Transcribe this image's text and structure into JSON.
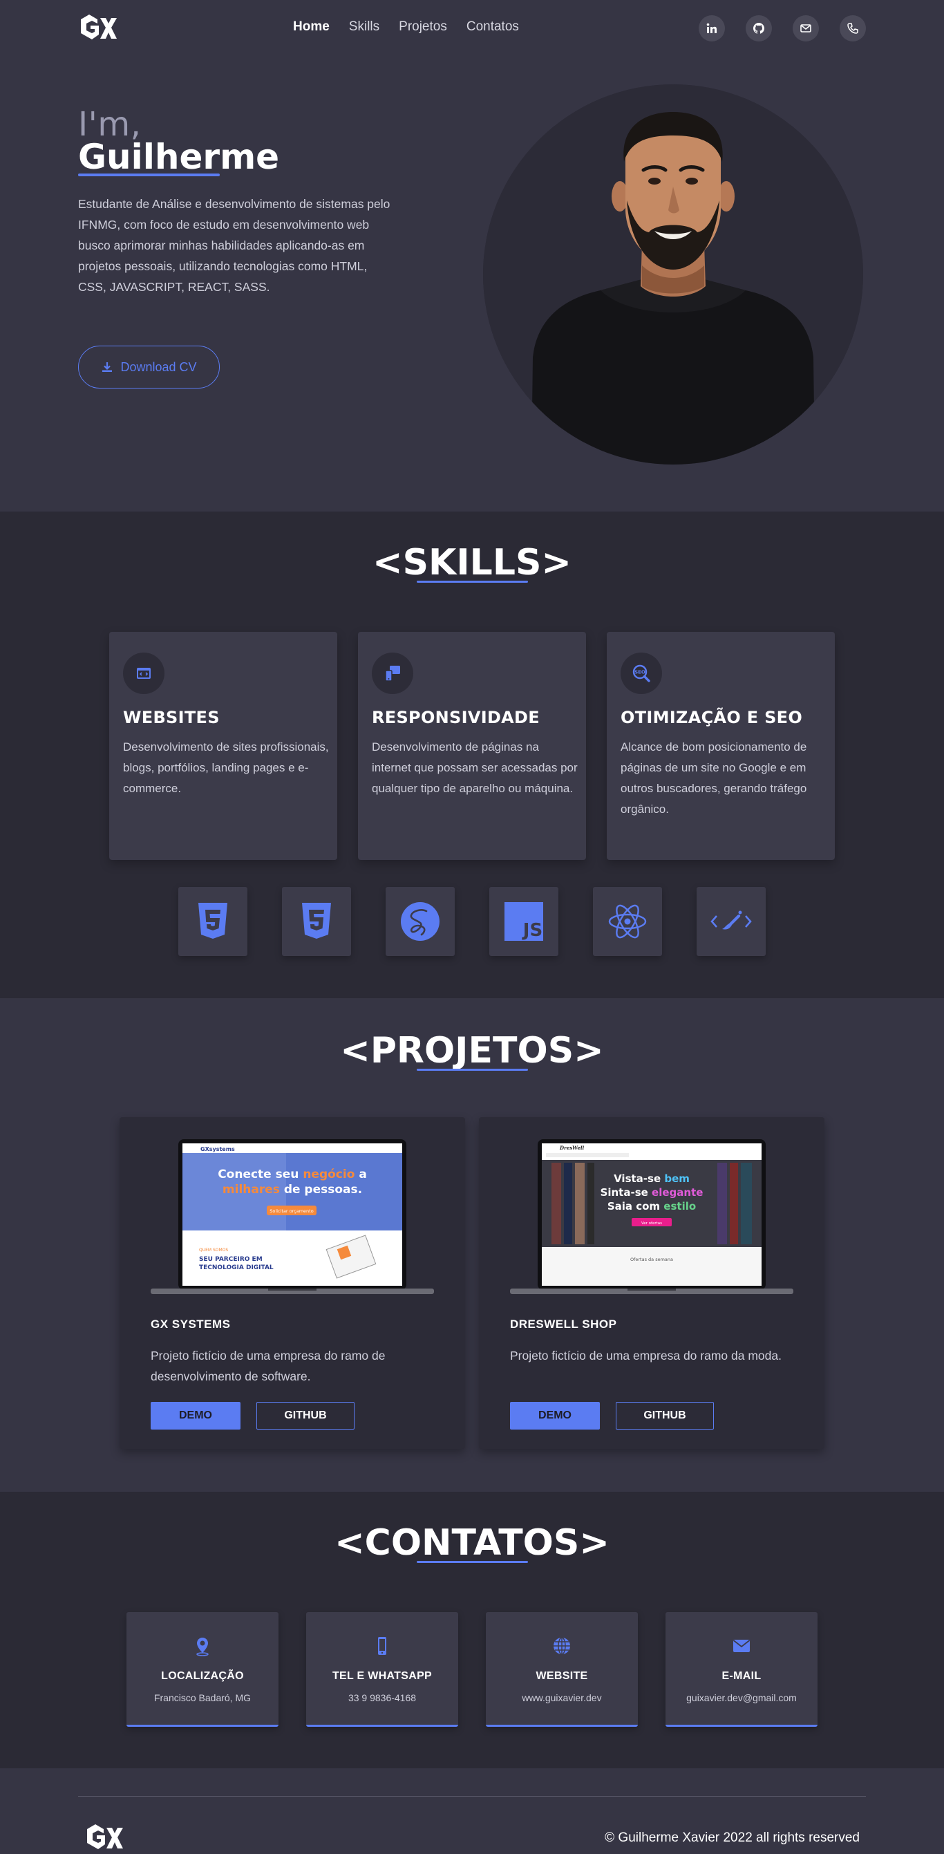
{
  "nav": {
    "items": [
      "Home",
      "Skills",
      "Projetos",
      "Contatos"
    ],
    "active": "Home"
  },
  "socials": [
    "linkedin-icon",
    "github-icon",
    "email-icon",
    "phone-icon"
  ],
  "hero": {
    "greeting": "I'm,",
    "name": "Guilherme",
    "description": "Estudante de Análise e desenvolvimento de sistemas pelo IFNMG, com foco de estudo em desenvolvimento web busco aprimorar minhas habilidades aplicando-as em projetos pessoais, utilizando tecnologias como HTML, CSS, JAVASCRIPT, REACT, SASS.",
    "cv_button": "Download CV"
  },
  "skills": {
    "title": "<SKILLS>",
    "cards": [
      {
        "icon": "code-window-icon",
        "title": "WEBSITES",
        "desc": "Desenvolvimento de sites profissionais, blogs, portfólios, landing pages e e-commerce."
      },
      {
        "icon": "devices-icon",
        "title": "RESPONSIVIDADE",
        "desc": "Desenvolvimento de páginas na internet que possam ser acessadas por qualquer tipo de aparelho ou máquina."
      },
      {
        "icon": "seo-icon",
        "title": "OTIMIZAÇÃO E SEO",
        "desc": "Alcance de bom posicionamento de páginas de um site no Google e em outros buscadores, gerando tráfego orgânico."
      }
    ],
    "techs": [
      "html5-icon",
      "css3-icon",
      "sass-icon",
      "javascript-icon",
      "react-icon",
      "styled-components-icon"
    ]
  },
  "projects": {
    "title": "<PROJETOS>",
    "items": [
      {
        "name": "GX SYSTEMS",
        "desc": "Projeto fictício de uma empresa do ramo de desenvolvimento de software.",
        "demo": "DEMO",
        "github": "GITHUB"
      },
      {
        "name": "DRESWELL SHOP",
        "desc": "Projeto fictício de uma empresa do ramo da moda.",
        "demo": "DEMO",
        "github": "GITHUB"
      }
    ],
    "screens": {
      "gx": {
        "brand": "GXsystems",
        "headline_1": "Conecte seu",
        "headline_hl1": "negócio",
        "headline_2": "a",
        "headline_hl2": "milhares",
        "headline_3": "de pessoas.",
        "cta": "Solicitar orçamento",
        "tagline": "QUEM SOMOS",
        "sub": "SEU PARCEIRO EM TECNOLOGIA DIGITAL"
      },
      "dw": {
        "brand": "DresWell",
        "line1a": "Vista-se",
        "line1b": "bem",
        "line2a": "Sinta-se",
        "line2b": "elegante",
        "line3a": "Saia com",
        "line3b": "estilo",
        "cta": "Ver ofertas",
        "offers": "Ofertas da semana"
      }
    }
  },
  "contacts": {
    "title": "<CONTATOS>",
    "items": [
      {
        "icon": "location-pin-icon",
        "label": "LOCALIZAÇÃO",
        "value": "Francisco Badaró, MG"
      },
      {
        "icon": "mobile-phone-icon",
        "label": "TEL E WHATSAPP",
        "value": "33 9 9836-4168"
      },
      {
        "icon": "globe-icon",
        "label": "WEBSITE",
        "value": "www.guixavier.dev"
      },
      {
        "icon": "envelope-icon",
        "label": "E-MAIL",
        "value": "guixavier.dev@gmail.com"
      }
    ]
  },
  "footer": {
    "copyright": "© Guilherme Xavier 2022 all rights reserved"
  },
  "colors": {
    "accent": "#5b7cf2",
    "bg_dark": "#2b2a35",
    "bg_mid": "#363544",
    "card": "#3c3b4a"
  }
}
